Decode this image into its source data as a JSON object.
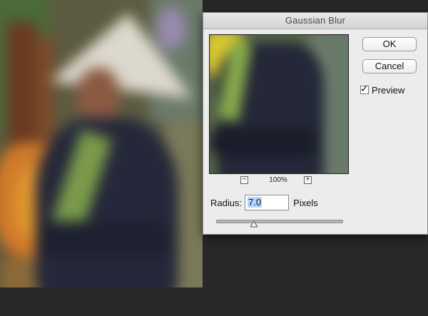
{
  "dialog": {
    "title": "Gaussian Blur",
    "ok_label": "OK",
    "cancel_label": "Cancel",
    "preview_label": "Preview",
    "preview_checked": true,
    "zoom_level": "100%",
    "zoom_out_symbol": "−",
    "zoom_in_symbol": "+",
    "radius_label": "Radius:",
    "radius_value": "7.0",
    "radius_unit": "Pixels",
    "slider_fraction": 0.3
  },
  "icons": {
    "zoom_out": "minus-icon",
    "zoom_in": "plus-icon",
    "check": "checkmark-icon",
    "slider": "triangle-slider-thumb-icon"
  },
  "colors": {
    "background": "#282828",
    "dialog_bg": "#ececec",
    "input_selection": "#b5d5ff"
  }
}
